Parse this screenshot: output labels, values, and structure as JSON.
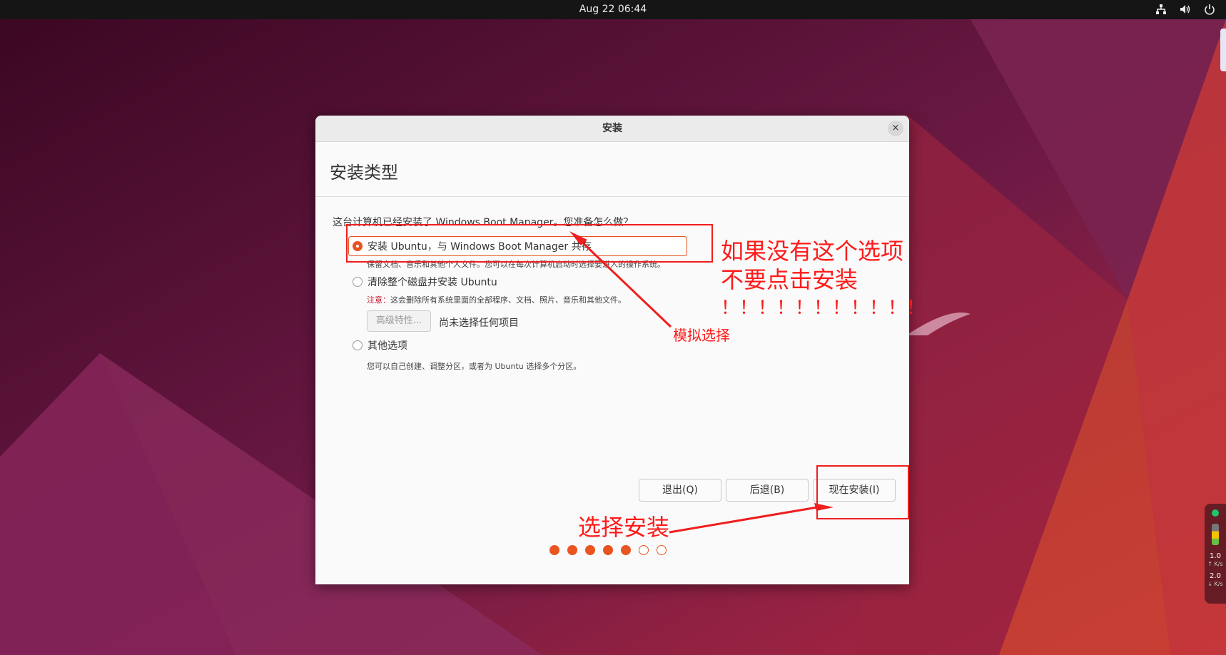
{
  "topbar": {
    "clock": "Aug 22  06:44",
    "icons": [
      "network-icon",
      "volume-icon",
      "power-icon"
    ]
  },
  "netwidget": {
    "up_rate": "1.0",
    "down_rate": "2.0",
    "up_unit": "↑ K/s",
    "down_unit": "↓ K/s"
  },
  "dialog": {
    "title": "安装",
    "close_glyph": "×",
    "page_title": "安装类型",
    "question": "这台计算机已经安装了 Windows Boot Manager。您准备怎么做？",
    "options": [
      {
        "label": "安装 Ubuntu，与 Windows Boot Manager 共存",
        "description": "保留文档、音乐和其他个人文件。您可以在每次计算机启动时选择要进入的操作系统。",
        "selected": true
      },
      {
        "label": "清除整个磁盘并安装 Ubuntu",
        "warning_prefix": "注意：",
        "description": "这会删除所有系统里面的全部程序、文档、照片、音乐和其他文件。",
        "selected": false
      },
      {
        "label": "其他选项",
        "description": "您可以自己创建、调整分区，或者为 Ubuntu 选择多个分区。",
        "selected": false
      }
    ],
    "advanced_button": "高级特性...",
    "advanced_status": "尚未选择任何项目",
    "buttons": {
      "quit": "退出(Q)",
      "back": "后退(B)",
      "install": "现在安装(I)"
    },
    "progress": {
      "total": 7,
      "completed": 5
    }
  },
  "annotations": {
    "arrow_label_top": "模拟选择",
    "note_line1": "如果没有这个选项",
    "note_line2": "不要点击安装",
    "note_line3": "！！！！！！！！！！！",
    "arrow_label_bottom": "选择安装",
    "color": "#ff1a1a"
  }
}
